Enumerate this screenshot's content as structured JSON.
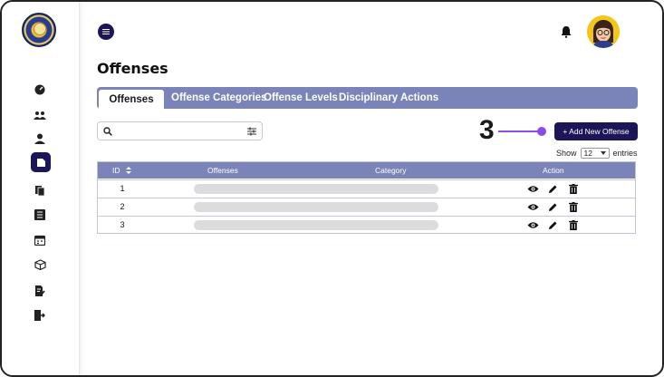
{
  "page": {
    "title": "Offenses"
  },
  "sidebar": {
    "items": [
      {
        "icon": "dashboard-icon"
      },
      {
        "icon": "users-icon"
      },
      {
        "icon": "user-icon"
      },
      {
        "icon": "folder-icon",
        "active": true
      },
      {
        "icon": "documents-icon"
      },
      {
        "icon": "list-icon"
      },
      {
        "icon": "calendar-icon"
      },
      {
        "icon": "box-icon"
      },
      {
        "icon": "edit-document-icon"
      },
      {
        "icon": "logout-icon"
      }
    ]
  },
  "tabs": [
    {
      "label": "Offenses",
      "active": true
    },
    {
      "label": "Offense Categories"
    },
    {
      "label": "Offense Levels"
    },
    {
      "label": "Disciplinary Actions"
    }
  ],
  "search": {
    "placeholder": "",
    "value": ""
  },
  "annotation": {
    "step": "3"
  },
  "toolbar": {
    "add_button_label": "+ Add New Offense"
  },
  "entries": {
    "show_label": "Show",
    "value": "12",
    "entries_label": "entries"
  },
  "table": {
    "columns": [
      "ID",
      "Offenses",
      "Category",
      "Action"
    ],
    "rows": [
      {
        "id": "1"
      },
      {
        "id": "2"
      },
      {
        "id": "3"
      }
    ]
  },
  "colors": {
    "primary": "#1c1558",
    "tab_bar": "#7b84b8",
    "annotation": "#8a4ee6"
  }
}
